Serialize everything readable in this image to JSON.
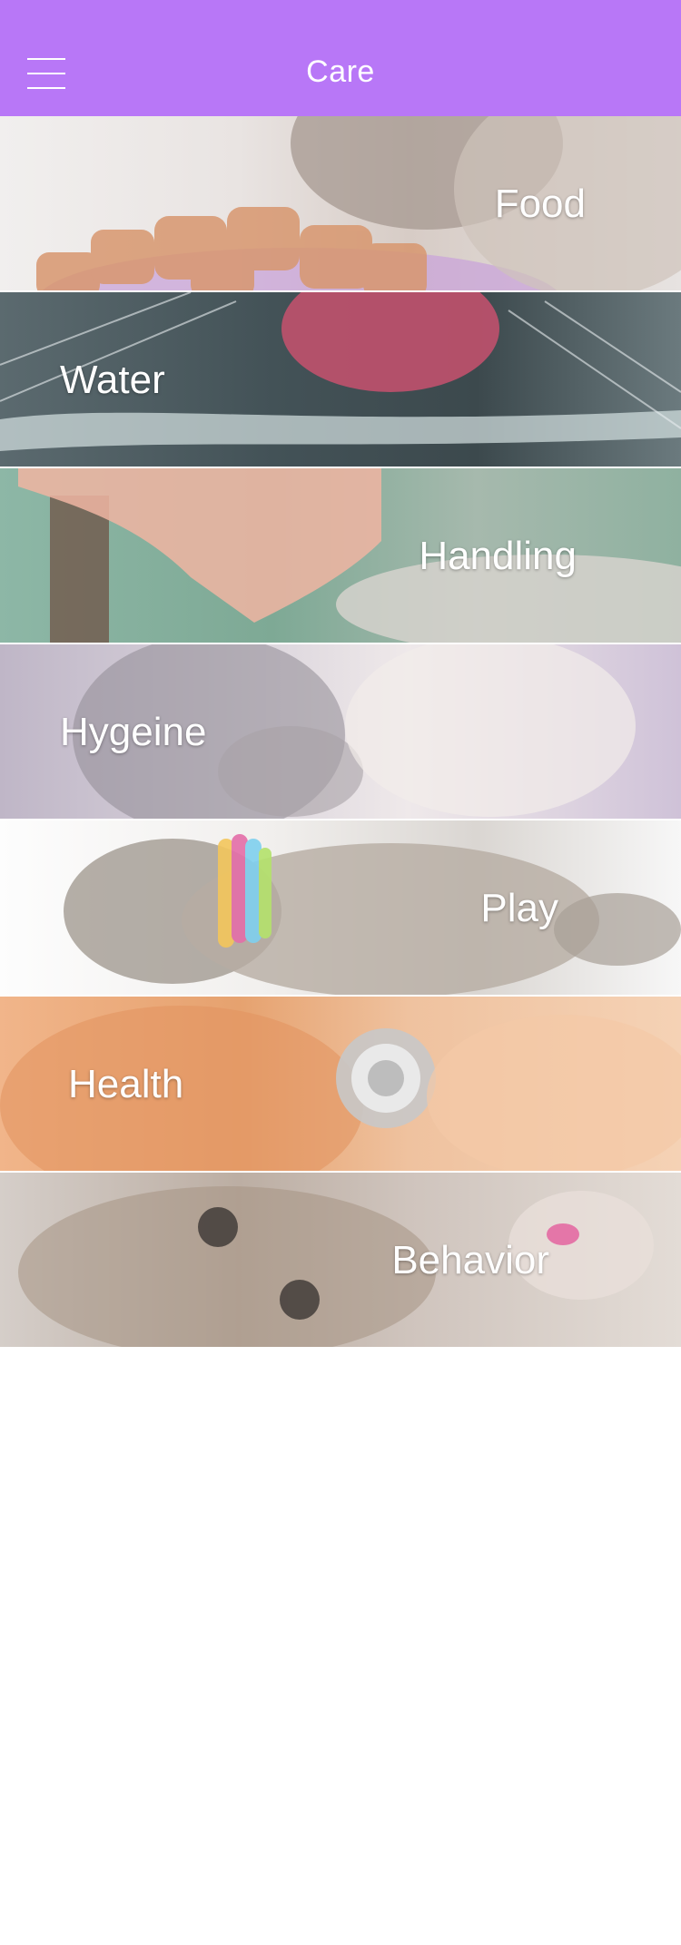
{
  "header": {
    "title": "Care",
    "menu_icon": "hamburger-menu-icon",
    "background_color": "#b877f7"
  },
  "categories": [
    {
      "label": "Food",
      "align": "right"
    },
    {
      "label": "Water",
      "align": "left"
    },
    {
      "label": "Handling",
      "align": "right"
    },
    {
      "label": "Hygeine",
      "align": "left"
    },
    {
      "label": "Play",
      "align": "right"
    },
    {
      "label": "Health",
      "align": "left"
    },
    {
      "label": "Behavior",
      "align": "right"
    }
  ]
}
